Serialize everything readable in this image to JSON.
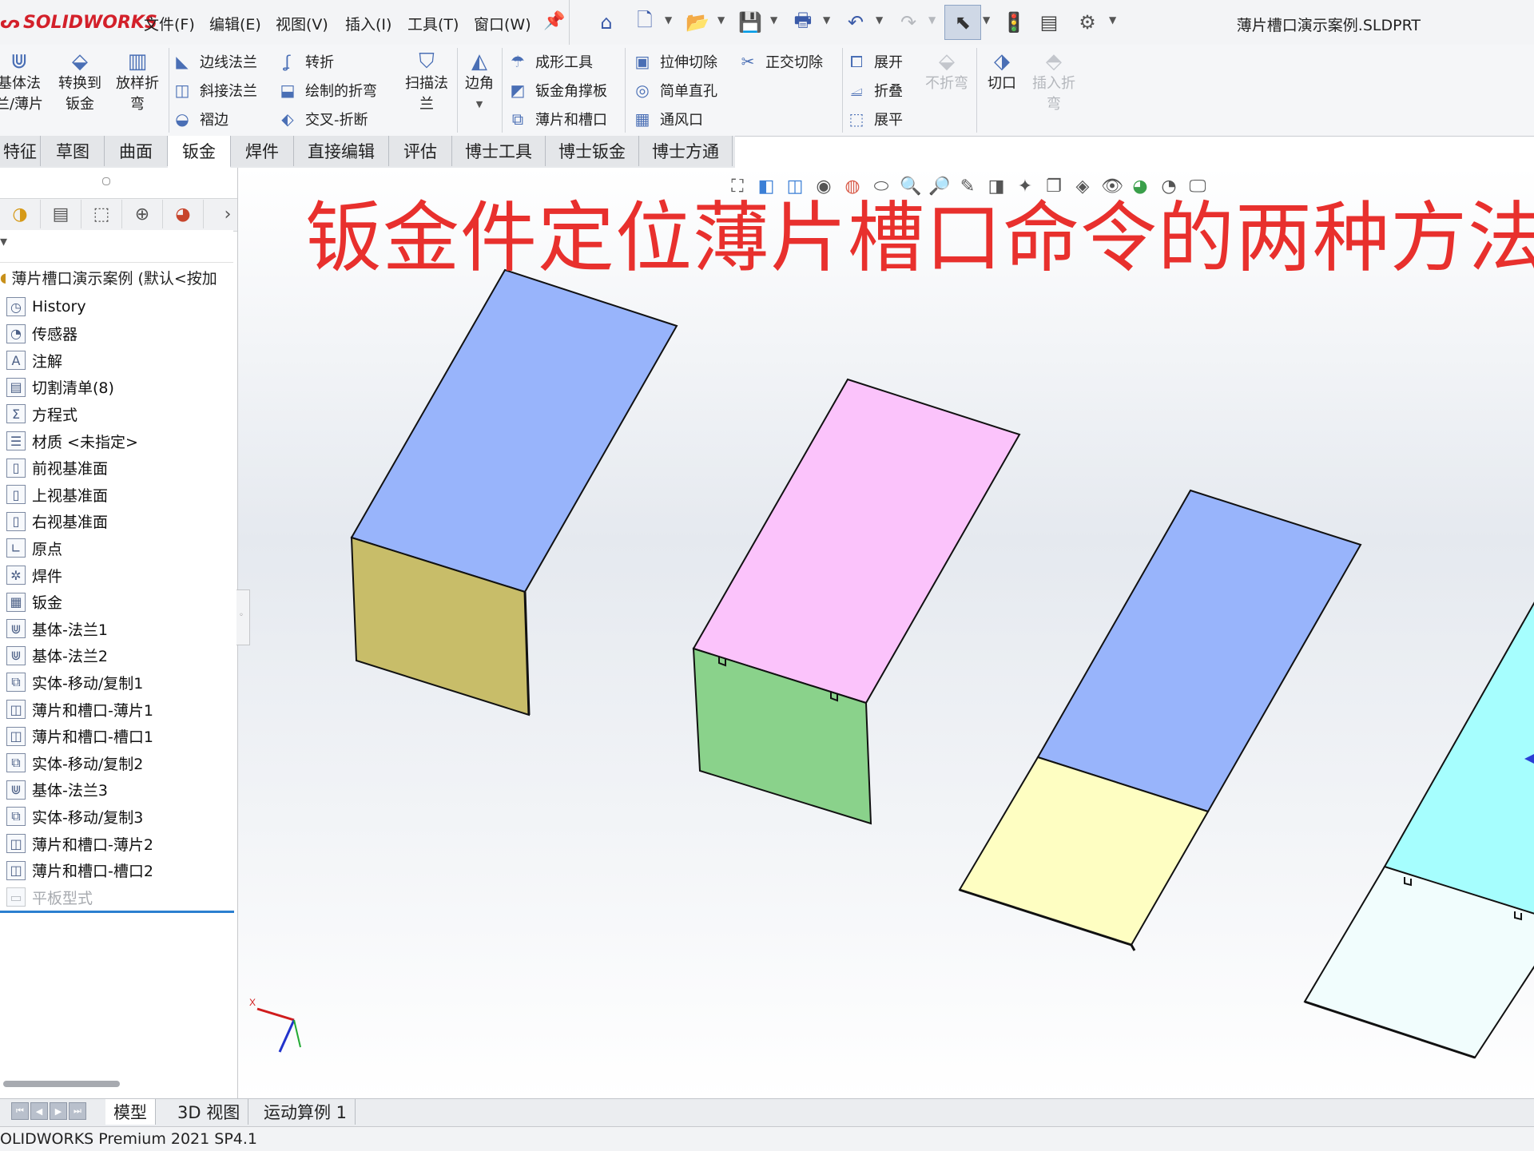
{
  "app": {
    "logo_text": "SOLIDWORKS",
    "document_title": "薄片槽口演示案例.SLDPRT",
    "status_text": "OLIDWORKS Premium 2021 SP4.1"
  },
  "menu": {
    "items": [
      "文件(F)",
      "编辑(E)",
      "视图(V)",
      "插入(I)",
      "工具(T)",
      "窗口(W)"
    ]
  },
  "quick_access": [
    "home-icon",
    "new-document-icon",
    "open-icon",
    "save-icon",
    "print-icon",
    "undo-icon",
    "redo-icon",
    "select-icon",
    "traffic-light-icon",
    "file-properties-icon",
    "options-gear-icon"
  ],
  "ribbon": {
    "big": {
      "base_flange": "基体法\n兰/薄片",
      "convert": "转换到\n钣金",
      "loft_bend": "放样折\n弯",
      "swept_flange": "扫描法\n兰",
      "corner": "边角",
      "unfold_disabled": "不折弯",
      "cut": "切口",
      "insert_bends": "插入折\n弯"
    },
    "small": {
      "edge_flange": "边线法兰",
      "jog": "转折",
      "miter_flange": "斜接法兰",
      "sketched_bend": "绘制的折弯",
      "hem": "褶边",
      "cross_break": "交叉-折断",
      "forming_tool": "成形工具",
      "gusset": "钣金角撑板",
      "tab_slot": "薄片和槽口",
      "extruded_cut": "拉伸切除",
      "normal_cut": "正交切除",
      "simple_hole": "简单直孔",
      "vent": "通风口",
      "unfold": "展开",
      "fold": "折叠",
      "flatten": "展平"
    }
  },
  "tabs": [
    "特征",
    "草图",
    "曲面",
    "钣金",
    "焊件",
    "直接编辑",
    "评估",
    "博士工具",
    "博士钣金",
    "博士方通"
  ],
  "active_tab": "钣金",
  "tree": {
    "root": "薄片槽口演示案例 (默认<按加",
    "items": [
      {
        "label": "History",
        "icon": "history-icon"
      },
      {
        "label": "传感器",
        "icon": "sensor-icon"
      },
      {
        "label": "注解",
        "icon": "annotation-icon"
      },
      {
        "label": "切割清单(8)",
        "icon": "cut-list-icon"
      },
      {
        "label": "方程式",
        "icon": "equation-icon"
      },
      {
        "label": "材质 <未指定>",
        "icon": "material-icon"
      },
      {
        "label": "前视基准面",
        "icon": "plane-icon"
      },
      {
        "label": "上视基准面",
        "icon": "plane-icon"
      },
      {
        "label": "右视基准面",
        "icon": "plane-icon"
      },
      {
        "label": "原点",
        "icon": "origin-icon"
      },
      {
        "label": "焊件",
        "icon": "weldment-icon"
      },
      {
        "label": "钣金",
        "icon": "sheet-metal-icon"
      },
      {
        "label": "基体-法兰1",
        "icon": "base-flange-icon"
      },
      {
        "label": "基体-法兰2",
        "icon": "base-flange-icon"
      },
      {
        "label": "实体-移动/复制1",
        "icon": "move-copy-icon"
      },
      {
        "label": "薄片和槽口-薄片1",
        "icon": "tab-slot-icon"
      },
      {
        "label": "薄片和槽口-槽口1",
        "icon": "tab-slot-icon"
      },
      {
        "label": "实体-移动/复制2",
        "icon": "move-copy-icon"
      },
      {
        "label": "基体-法兰3",
        "icon": "base-flange-icon"
      },
      {
        "label": "实体-移动/复制3",
        "icon": "move-copy-icon"
      },
      {
        "label": "薄片和槽口-薄片2",
        "icon": "tab-slot-icon"
      },
      {
        "label": "薄片和槽口-槽口2",
        "icon": "tab-slot-icon"
      },
      {
        "label": "平板型式",
        "icon": "flat-pattern-icon",
        "suppressed": true
      }
    ]
  },
  "viewport": {
    "overlay_title": "钣金件定位薄片槽口命令的两种方法",
    "triad_x_label": "X",
    "colors": {
      "blue_face": "#98b4fb",
      "olive_face": "#c8bd69",
      "pink_face": "#fbc3fb",
      "green_face": "#8ad28b",
      "yellow_face": "#fefec2",
      "cyan_face": "#a6fefe",
      "pale_face": "#f1fdfd"
    }
  },
  "bottom_tabs": [
    "模型",
    "3D 视图",
    "运动算例 1"
  ],
  "active_bottom_tab": "模型"
}
